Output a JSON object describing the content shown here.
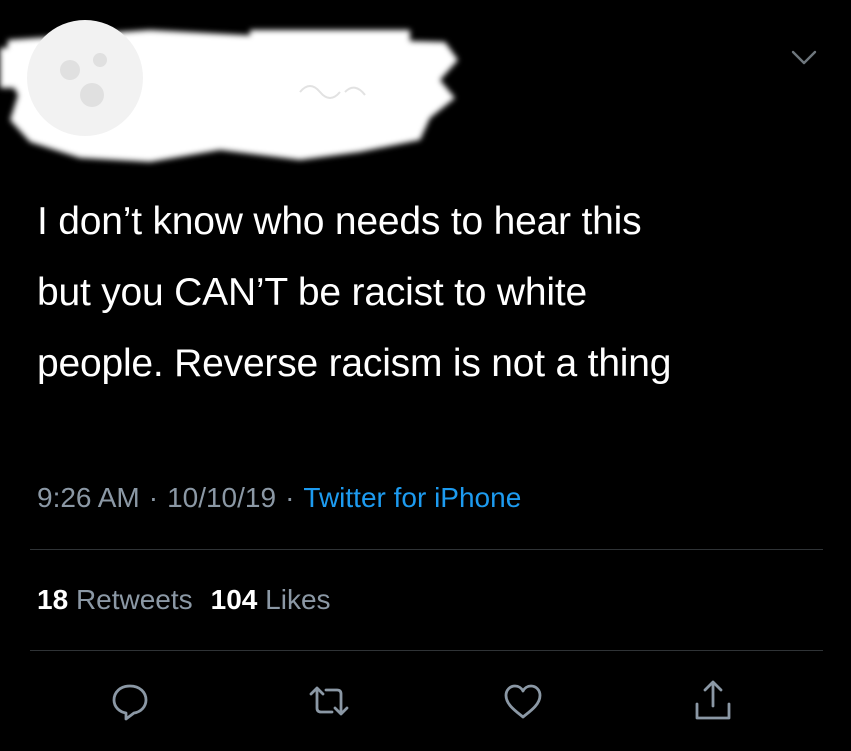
{
  "tweet": {
    "text_lines": [
      "I don’t know who needs to hear this",
      "but you CAN’T be racist to white",
      "people. Reverse racism is not a thing"
    ]
  },
  "meta": {
    "time": "9:26 AM",
    "separator": "·",
    "date": "10/10/19",
    "source": "Twitter for iPhone"
  },
  "stats": {
    "retweets_count": "18",
    "retweets_label": "Retweets",
    "likes_count": "104",
    "likes_label": "Likes"
  },
  "colors": {
    "background": "#000000",
    "text": "#ffffff",
    "secondary_text": "#8b98a5",
    "link": "#1d9bf0",
    "divider": "#2f3336"
  },
  "icons": {
    "menu": "chevron-down-icon",
    "reply": "reply-icon",
    "retweet": "retweet-icon",
    "like": "heart-icon",
    "share": "share-icon"
  }
}
